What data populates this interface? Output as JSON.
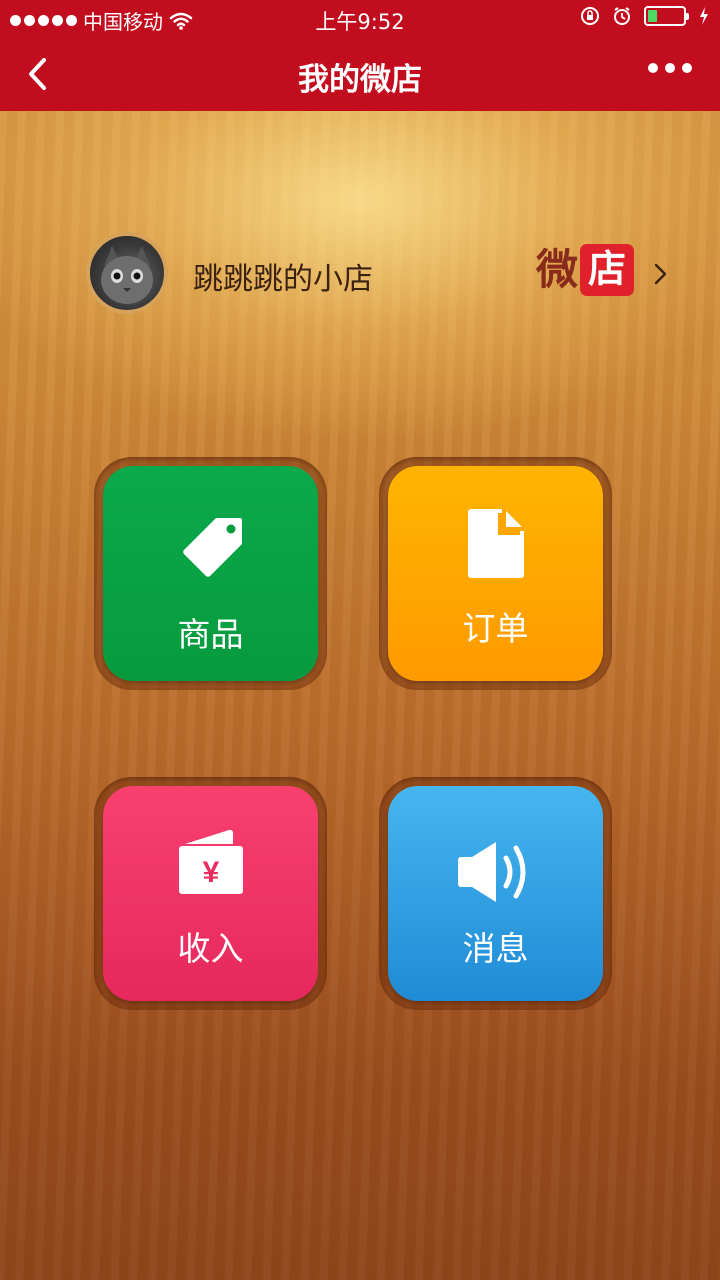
{
  "status_bar": {
    "carrier": "中国移动",
    "time": "上午9:52",
    "battery_level": 0.25
  },
  "nav": {
    "title": "我的微店"
  },
  "shop": {
    "name": "跳跳跳的小店",
    "logo_part1": "微",
    "logo_part2": "店"
  },
  "tiles": [
    {
      "label": "商品",
      "icon": "tag-icon",
      "color": "#0aa94b"
    },
    {
      "label": "订单",
      "icon": "document-icon",
      "color": "#ffa500"
    },
    {
      "label": "收入",
      "icon": "wallet-yuan-icon",
      "color": "#f03a68"
    },
    {
      "label": "消息",
      "icon": "speaker-icon",
      "color": "#33a3e6"
    }
  ],
  "colors": {
    "header": "#c20d1e",
    "logo_badge": "#e0202a"
  }
}
